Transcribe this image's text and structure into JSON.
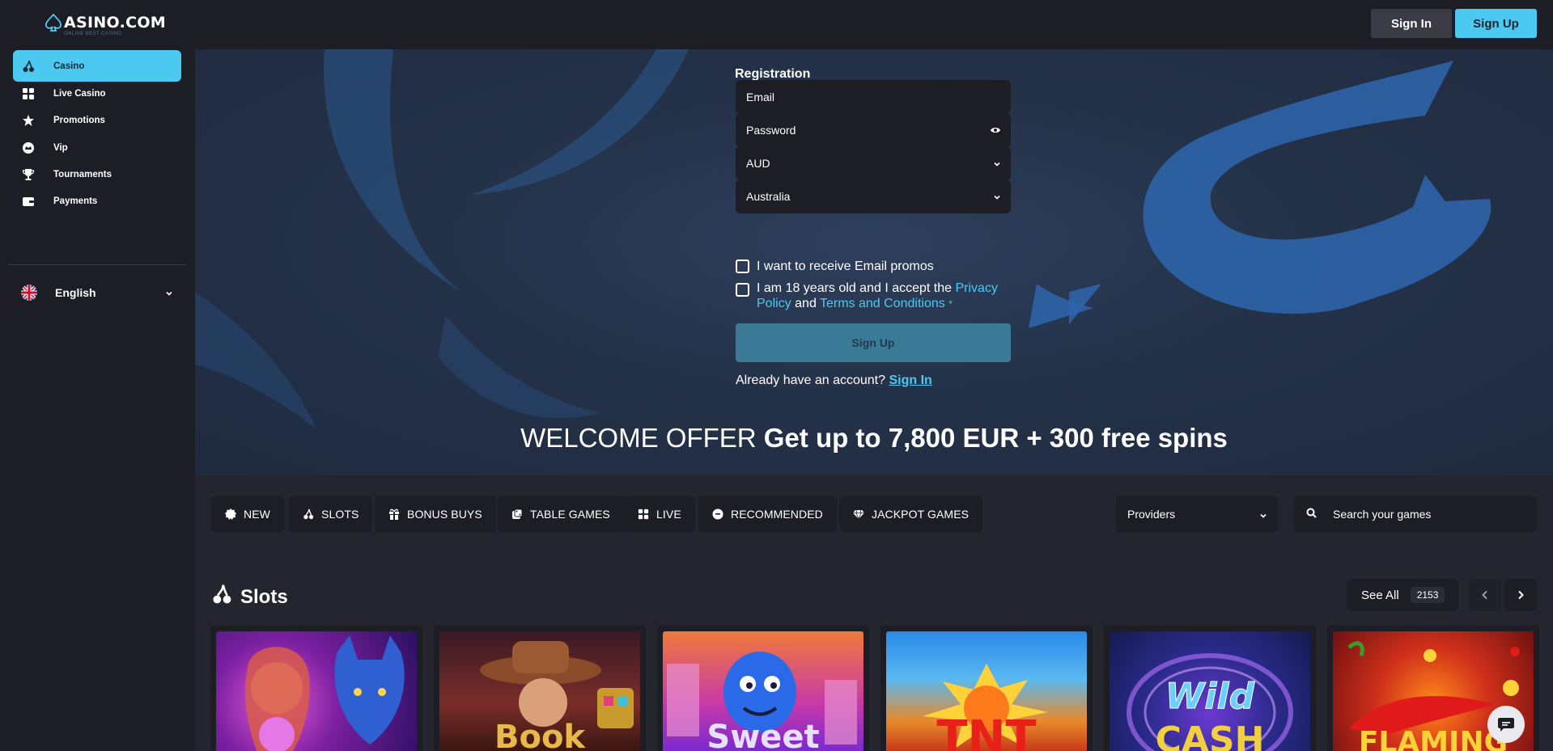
{
  "header": {
    "logo_text": "ASINO.COM",
    "logo_tagline": "ONLINE BEST CASINO",
    "signin_label": "Sign In",
    "signup_label": "Sign Up"
  },
  "sidebar": {
    "items": [
      {
        "label": "Casino",
        "icon": "cherries-icon",
        "active": true
      },
      {
        "label": "Live Casino",
        "icon": "grid-icon"
      },
      {
        "label": "Promotions",
        "icon": "star-badge-icon"
      },
      {
        "label": "Vip",
        "icon": "crown-icon"
      },
      {
        "label": "Tournaments",
        "icon": "trophy-icon"
      },
      {
        "label": "Payments",
        "icon": "wallet-icon"
      }
    ],
    "language": "English"
  },
  "registration": {
    "title": "Registration",
    "email_placeholder": "Email",
    "password_placeholder": "Password",
    "currency": "AUD",
    "country": "Australia",
    "email_promos_label": "I want to receive Email promos",
    "terms_prefix": "I am 18 years old and I accept the",
    "privacy_link": "Privacy Policy",
    "terms_and": "and",
    "terms_link": "Terms and Conditions",
    "required_mark": "*",
    "submit_label": "Sign Up",
    "have_account": "Already have an account?",
    "signin_link": "Sign In"
  },
  "welcome": {
    "prefix": "WELCOME OFFER",
    "offer": "Get up to 7,800 EUR + 300 free spins"
  },
  "filters": {
    "chips": [
      {
        "label": "NEW",
        "icon": "new-badge-icon"
      },
      {
        "label": "SLOTS",
        "icon": "cherries-icon"
      },
      {
        "label": "BONUS BUYS",
        "icon": "gift-icon"
      },
      {
        "label": "TABLE GAMES",
        "icon": "dice-icon"
      },
      {
        "label": "LIVE",
        "icon": "grid-icon"
      },
      {
        "label": "RECOMMENDED",
        "icon": "smile-icon"
      },
      {
        "label": "JACKPOT GAMES",
        "icon": "diamond-icon"
      }
    ],
    "providers_label": "Providers",
    "search_placeholder": "Search your games"
  },
  "slots": {
    "title": "Slots",
    "see_all_label": "See All",
    "count": "2153",
    "games": [
      {
        "name": "fortune-wolf-game",
        "art_text": ""
      },
      {
        "name": "cowboy-game",
        "art_text": "Book"
      },
      {
        "name": "sweet-genie-game",
        "art_text": "Sweet"
      },
      {
        "name": "tnt-game",
        "art_text": "TNT"
      },
      {
        "name": "wild-cash-game",
        "art_text": "CASH"
      },
      {
        "name": "flaming-game",
        "art_text": "FLAMING"
      }
    ]
  },
  "colors": {
    "accent": "#4cc9f0",
    "panel": "#1d1d26",
    "background": "#25252f"
  }
}
